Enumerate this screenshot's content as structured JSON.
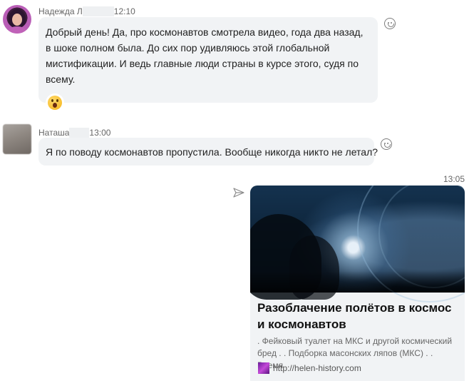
{
  "messages": [
    {
      "sender": "Надежда Л",
      "time": "12:10",
      "text": "Добрый день! Да, про космонавтов смотрела видео, года два назад, в шоке полном была. До сих пор удивляюсь этой глобальной мистификации. И ведь главные люди страны в курсе этого, судя по всему.",
      "reaction_icon": "astonished-face-emoji"
    },
    {
      "sender": "Наташа",
      "time": "13:00",
      "text": "Я по поводу космонавтов пропустила. Вообще никогда никто не летал?"
    }
  ],
  "outgoing": {
    "time": "13:05",
    "link_preview": {
      "title": "Разоблачение полётов в космос и космонавтов",
      "description": ". Фейковый туалет на МКС и другой космический бред . . Подборка масонских ляпов (МКС) . . Время",
      "url": "http://helen-history.com"
    }
  },
  "colors": {
    "bubble": "#f1f3f5",
    "secondary_text": "#666666"
  }
}
